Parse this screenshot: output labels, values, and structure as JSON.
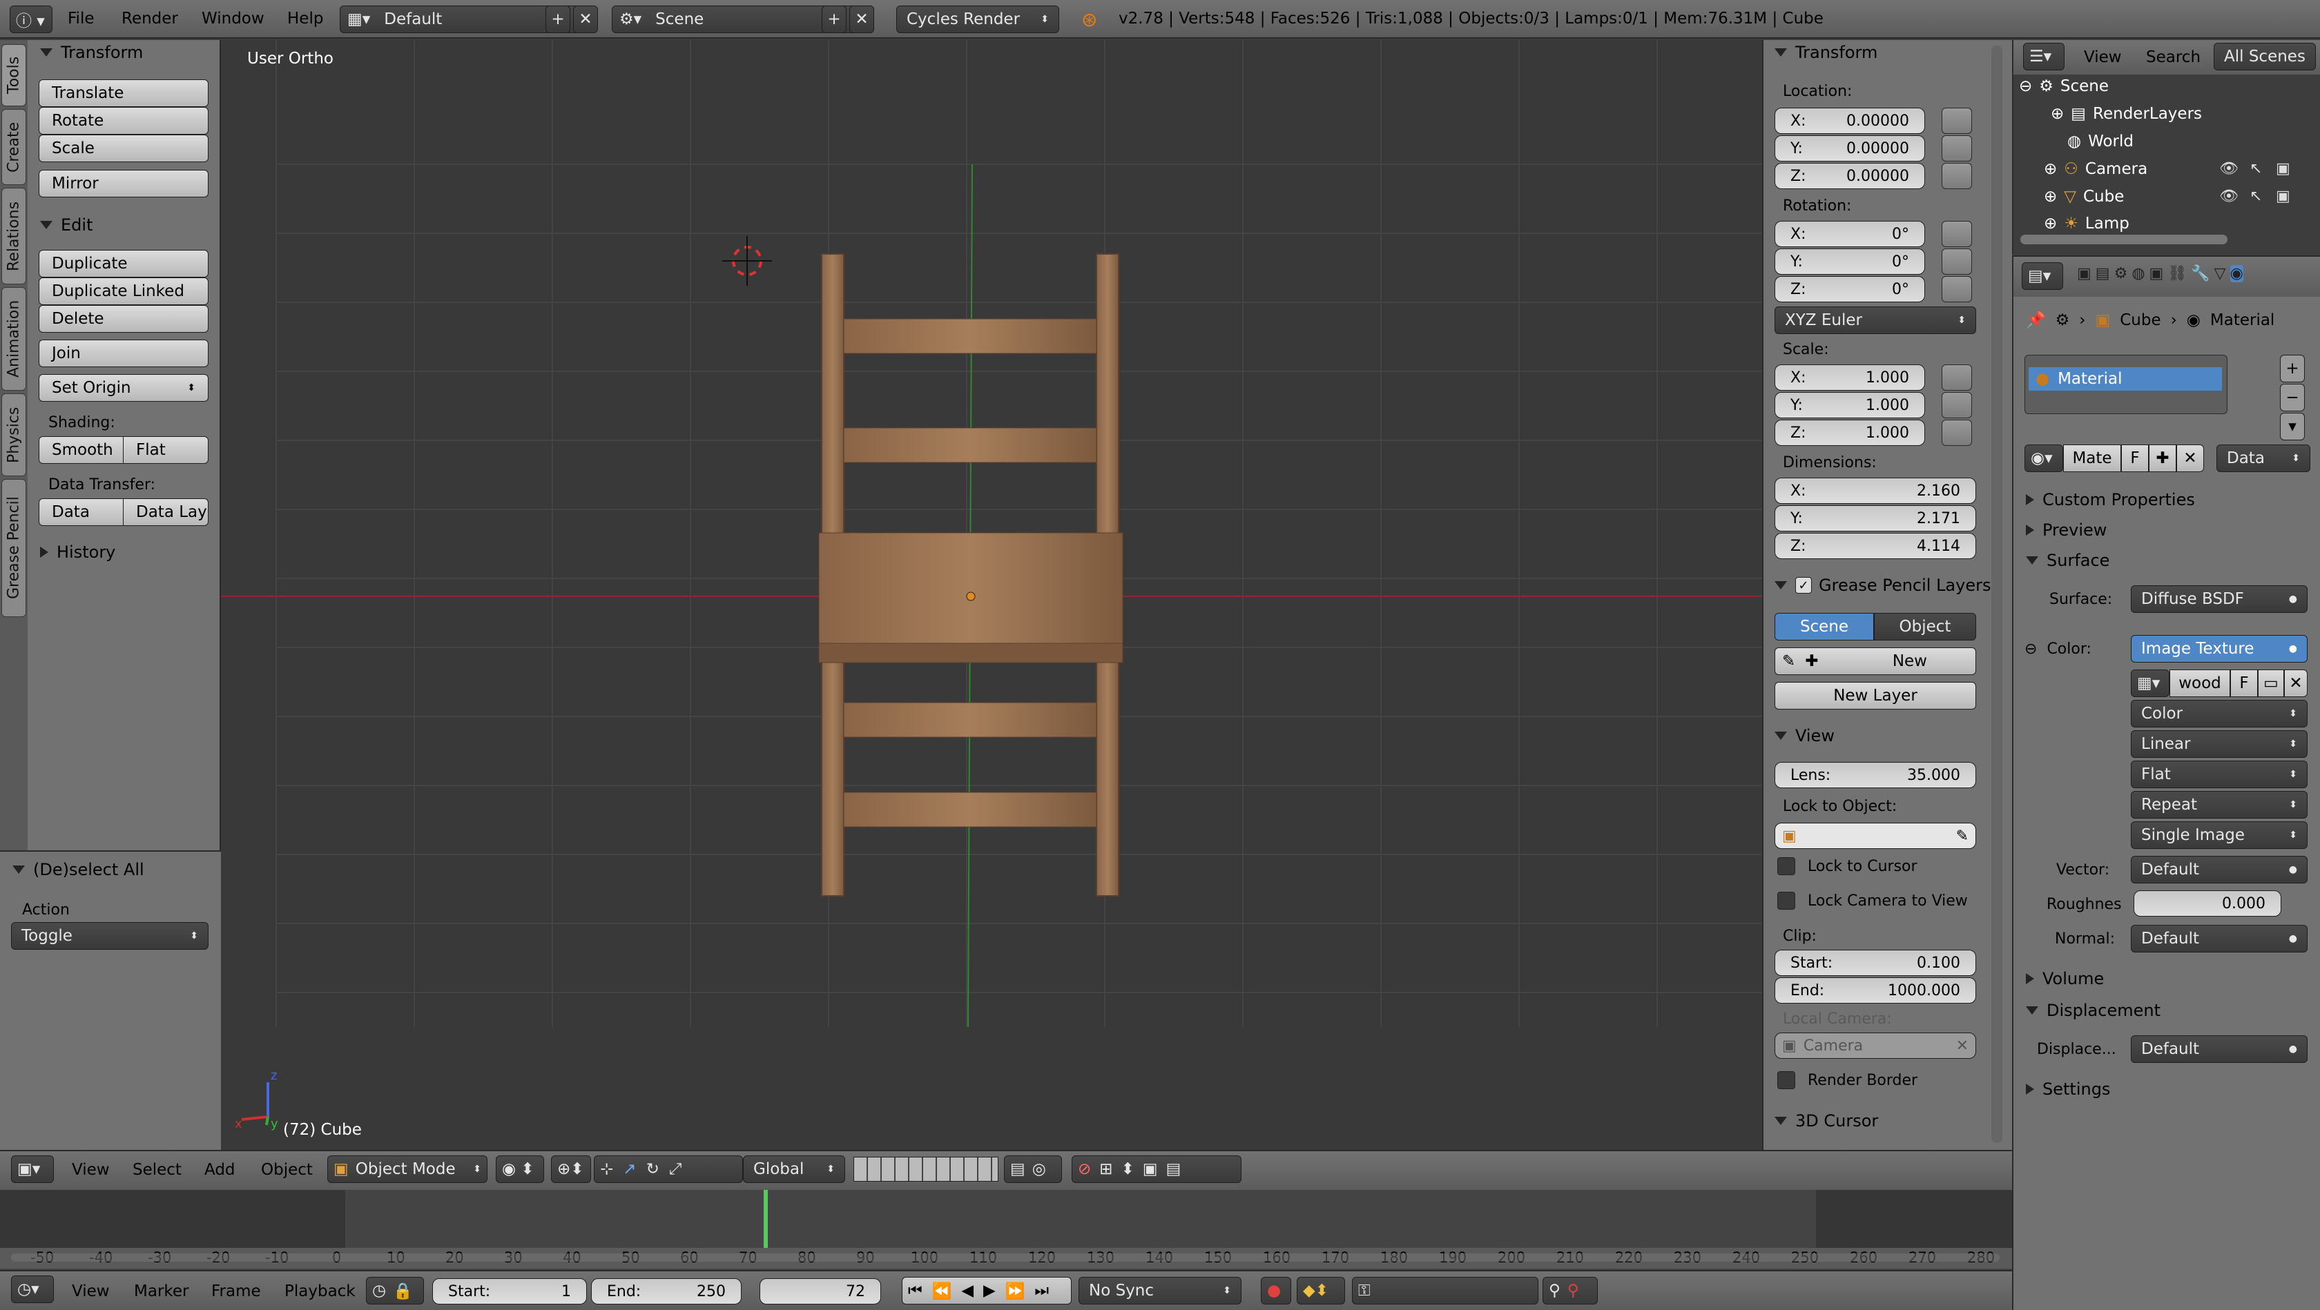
{
  "topbar": {
    "menus": [
      "File",
      "Render",
      "Window",
      "Help"
    ],
    "layout": "Default",
    "scene": "Scene",
    "engine": "Cycles Render",
    "stats": "v2.78 | Verts:548 | Faces:526 | Tris:1,088 | Objects:0/3 | Lamps:0/1 | Mem:76.31M | Cube"
  },
  "tools": {
    "tabs": [
      "Tools",
      "Create",
      "Relations",
      "Animation",
      "Physics",
      "Grease Pencil"
    ],
    "transform_title": "Transform",
    "translate": "Translate",
    "rotate": "Rotate",
    "scale": "Scale",
    "mirror": "Mirror",
    "edit_title": "Edit",
    "duplicate": "Duplicate",
    "duplicate_linked": "Duplicate Linked",
    "delete": "Delete",
    "join": "Join",
    "set_origin": "Set Origin",
    "shading_label": "Shading:",
    "smooth": "Smooth",
    "flat": "Flat",
    "data_transfer_label": "Data Transfer:",
    "data": "Data",
    "data_lay": "Data Lay",
    "history": "History",
    "op_title": "(De)select All",
    "action_label": "Action",
    "action_value": "Toggle"
  },
  "viewport": {
    "view_label": "User Ortho",
    "object_label": "(72) Cube",
    "axis_x": "x",
    "axis_y": "y",
    "axis_z": "z"
  },
  "props": {
    "transform": "Transform",
    "location": "Location:",
    "loc": [
      "X:",
      "0.00000",
      "Y:",
      "0.00000",
      "Z:",
      "0.00000"
    ],
    "rotation": "Rotation:",
    "rot": [
      "X:",
      "0°",
      "Y:",
      "0°",
      "Z:",
      "0°"
    ],
    "rot_mode": "XYZ Euler",
    "scale": "Scale:",
    "scl": [
      "X:",
      "1.000",
      "Y:",
      "1.000",
      "Z:",
      "1.000"
    ],
    "dimensions": "Dimensions:",
    "dim": [
      "X:",
      "2.160",
      "Y:",
      "2.171",
      "Z:",
      "4.114"
    ],
    "gp_layers": "Grease Pencil Layers",
    "gp_scene": "Scene",
    "gp_object": "Object",
    "gp_new": "New",
    "gp_new_layer": "New Layer",
    "view": "View",
    "lens_label": "Lens:",
    "lens": "35.000",
    "lock_obj": "Lock to Object:",
    "lock_cursor": "Lock to Cursor",
    "lock_camera": "Lock Camera to View",
    "clip": "Clip:",
    "clip_start_label": "Start:",
    "clip_start": "0.100",
    "clip_end_label": "End:",
    "clip_end": "1000.000",
    "local_camera": "Local Camera:",
    "camera": "Camera",
    "render_border": "Render Border",
    "cursor3d": "3D Cursor"
  },
  "outliner": {
    "view": "View",
    "search": "Search",
    "all_scenes": "All Scenes",
    "items": [
      "Scene",
      "RenderLayers",
      "World",
      "Camera",
      "Cube",
      "Lamp"
    ]
  },
  "material": {
    "breadcrumb_obj": "Cube",
    "breadcrumb_mat": "Material",
    "slot": "Material",
    "mate": "Mate",
    "f": "F",
    "data": "Data",
    "custom_props": "Custom Properties",
    "preview": "Preview",
    "surface": "Surface",
    "surface_label": "Surface:",
    "surface_value": "Diffuse BSDF",
    "color_label": "Color:",
    "color_value": "Image Texture",
    "image": "wood",
    "img_f": "F",
    "opts": [
      "Color",
      "Linear",
      "Flat",
      "Repeat",
      "Single Image"
    ],
    "vector_label": "Vector:",
    "vector_value": "Default",
    "rough_label": "Roughnes",
    "rough_value": "0.000",
    "normal_label": "Normal:",
    "normal_value": "Default",
    "volume": "Volume",
    "displacement": "Displacement",
    "disp_label": "Displace...",
    "disp_value": "Default",
    "settings": "Settings"
  },
  "view3d_header": {
    "menus": [
      "View",
      "Select",
      "Add",
      "Object"
    ],
    "mode": "Object Mode",
    "orientation": "Global"
  },
  "timeline": {
    "ticks": [
      "-50",
      "-40",
      "-30",
      "-20",
      "-10",
      "0",
      "10",
      "20",
      "30",
      "40",
      "50",
      "60",
      "70",
      "80",
      "90",
      "100",
      "110",
      "120",
      "130",
      "140",
      "150",
      "160",
      "170",
      "180",
      "190",
      "200",
      "210",
      "220",
      "230",
      "240",
      "250",
      "260",
      "270",
      "280"
    ],
    "menus": [
      "View",
      "Marker",
      "Frame",
      "Playback"
    ],
    "start_label": "Start:",
    "start": "1",
    "end_label": "End:",
    "end": "250",
    "current": "72",
    "sync": "No Sync"
  }
}
